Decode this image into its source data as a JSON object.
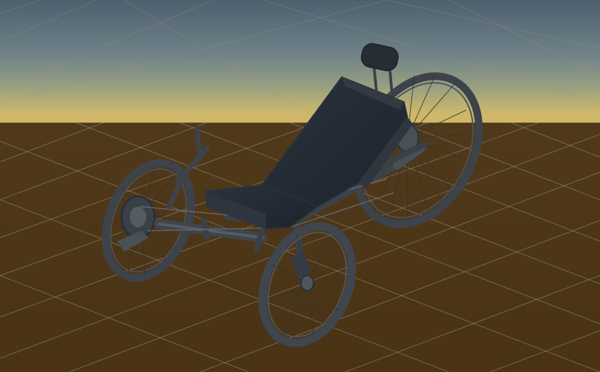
{
  "colors": {
    "sky_top": "#516270",
    "sky_mid": "#71848a",
    "horizon_glow": "#c9b46a",
    "ground": "#4a3414",
    "grid_line": "#8f8a80",
    "model_dark": "#222a33",
    "model_frame": "#3b4047",
    "model_light": "#5a5f67"
  },
  "scene": {
    "object": "recumbent-trike-model",
    "view": "perspective",
    "grid": true
  }
}
